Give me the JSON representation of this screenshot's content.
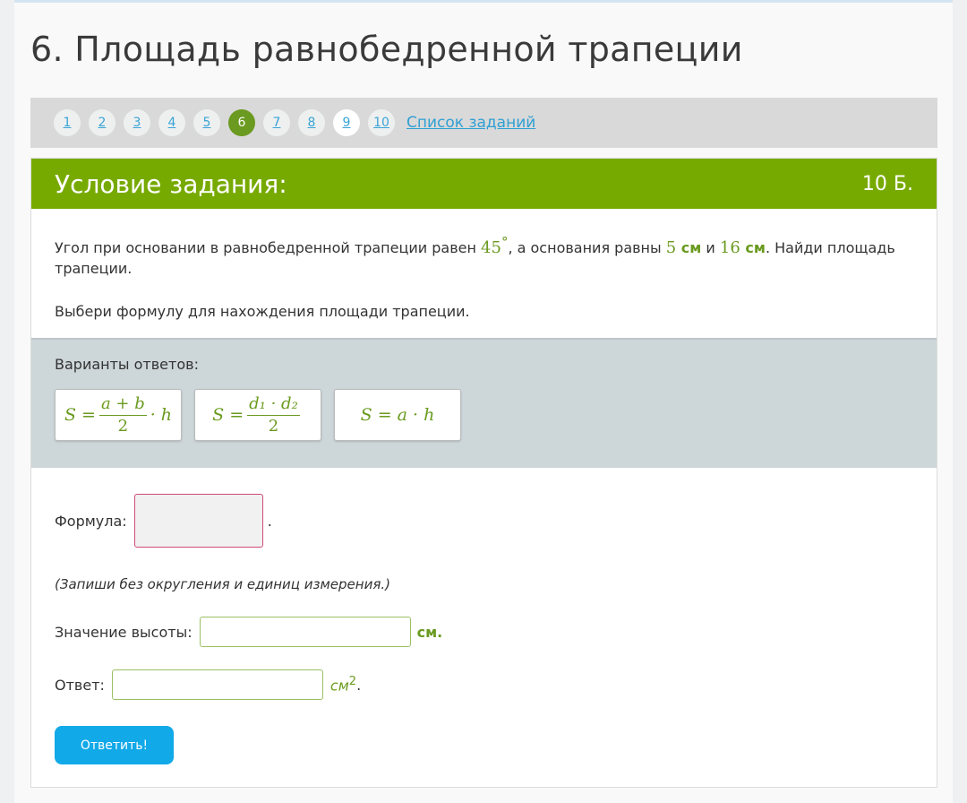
{
  "page": {
    "title": "6. Площадь равнобедренной трапеции"
  },
  "nav": {
    "items": [
      "1",
      "2",
      "3",
      "4",
      "5",
      "6",
      "7",
      "8",
      "9",
      "10"
    ],
    "active": "6",
    "list_label": "Список заданий"
  },
  "task": {
    "header_title": "Условие задания:",
    "points": "10 Б.",
    "condition": {
      "t1": "Угол при основании в равнобедренной трапеции равен ",
      "angle": "45",
      "degree": "°",
      "t2": ", а основания равны ",
      "b1": "5",
      "b1_unit": " см",
      "t3": " и ",
      "b2": "16",
      "b2_unit": " см",
      "t4": ". Найди площадь трапеции."
    },
    "question": "Выбери формулу для нахождения площади трапеции."
  },
  "answers": {
    "label": "Варианты ответов:",
    "options": [
      {
        "lhs": "S =",
        "num": "a + b",
        "den": "2",
        "tail": "· h"
      },
      {
        "lhs": "S =",
        "num": "d₁ · d₂",
        "den": "2"
      },
      {
        "text": "S = a · h"
      }
    ]
  },
  "form": {
    "formula_label": "Формула:",
    "formula_after": ".",
    "note": "(Запиши без округления и единиц измерения.)",
    "height_label": "Значение высоты:",
    "height_value": "",
    "height_unit": "см.",
    "answer_label": "Ответ:",
    "answer_value": "",
    "answer_unit": "см",
    "answer_unit_sup": "2",
    "answer_after": ".",
    "submit_label": "Ответить!"
  },
  "colors": {
    "accent_green": "#77aa00",
    "text_green": "#6a9a1f",
    "link_blue": "#2f9fd3",
    "button_blue": "#11a9e8",
    "drop_border": "#d04a78"
  }
}
